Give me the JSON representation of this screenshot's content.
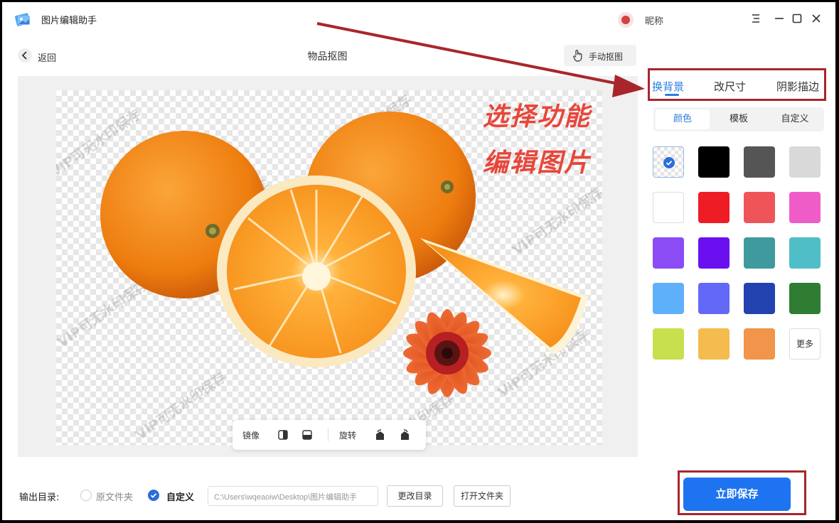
{
  "app": {
    "title": "图片编辑助手",
    "user_name": "昵称"
  },
  "header": {
    "back_label": "返回",
    "page_title": "物品抠图",
    "manual_label": "手动抠图"
  },
  "canvas": {
    "watermark_text": "VIP可无水印保存",
    "toolbar": {
      "mirror_label": "镜像",
      "rotate_label": "旋转"
    }
  },
  "annotation": {
    "line1": "选择功能",
    "line2": "编辑图片"
  },
  "panel": {
    "tabs": [
      {
        "label": "换背景",
        "active": true
      },
      {
        "label": "改尺寸",
        "active": false
      },
      {
        "label": "阴影描边",
        "active": false
      }
    ],
    "subtabs": [
      {
        "label": "颜色",
        "active": true
      },
      {
        "label": "模板",
        "active": false
      },
      {
        "label": "自定义",
        "active": false
      }
    ],
    "swatches": [
      "transparent",
      "#000000",
      "#555555",
      "#d9d9d9",
      "#ffffff",
      "#ee1c25",
      "#ef5558",
      "#ef5cc8",
      "#8b4cf6",
      "#6a10f0",
      "#3e9a9c",
      "#4fbec6",
      "#5fb0fa",
      "#6368f6",
      "#2242b0",
      "#2e7d32",
      "#c8e04e",
      "#f4bb4f",
      "#f0954a"
    ],
    "more_label": "更多"
  },
  "bottom": {
    "output_label": "输出目录:",
    "option_original": "原文件夹",
    "option_custom": "自定义",
    "path": "C:\\Users\\wqeaoiw\\Desktop\\图片编辑助手",
    "change_dir_label": "更改目录",
    "open_folder_label": "打开文件夹",
    "save_label": "立即保存"
  }
}
